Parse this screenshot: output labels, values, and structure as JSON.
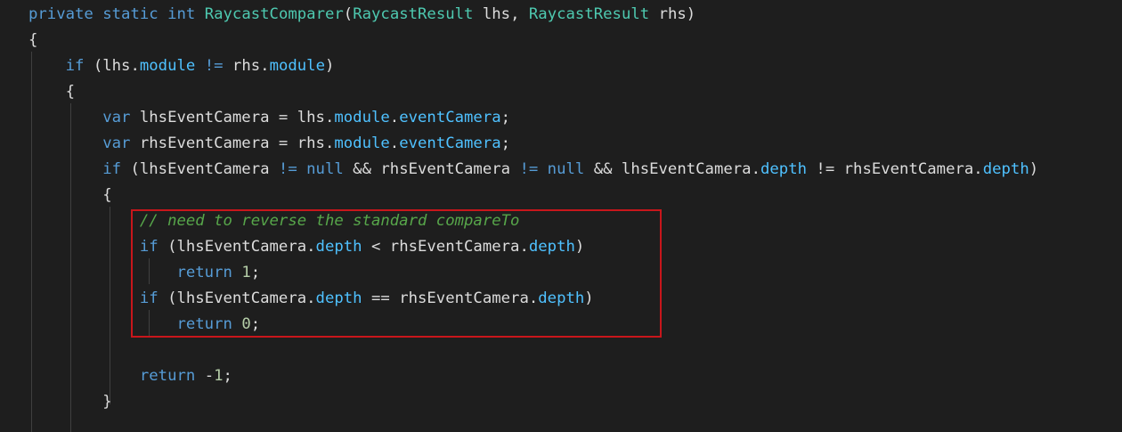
{
  "code": {
    "language": "C#",
    "lines": [
      {
        "tokens": [
          [
            "private",
            "kw"
          ],
          [
            " ",
            ""
          ],
          [
            "static",
            "kw"
          ],
          [
            " ",
            ""
          ],
          [
            "int",
            "kw"
          ],
          [
            " ",
            ""
          ],
          [
            "RaycastComparer",
            "fn"
          ],
          [
            "(",
            ""
          ],
          [
            "RaycastResult",
            "cls"
          ],
          [
            " lhs, ",
            ""
          ],
          [
            "RaycastResult",
            "cls"
          ],
          [
            " rhs)",
            ""
          ]
        ]
      },
      {
        "tokens": [
          [
            "{",
            ""
          ]
        ]
      },
      {
        "tokens": [
          [
            "    ",
            ""
          ],
          [
            "if",
            "kw"
          ],
          [
            " (lhs.",
            ""
          ],
          [
            "module",
            "mem"
          ],
          [
            " ",
            ""
          ],
          [
            "!=",
            "kw"
          ],
          [
            " rhs.",
            ""
          ],
          [
            "module",
            "mem"
          ],
          [
            ")",
            ""
          ]
        ]
      },
      {
        "tokens": [
          [
            "    {",
            ""
          ]
        ]
      },
      {
        "tokens": [
          [
            "        ",
            ""
          ],
          [
            "var",
            "kw"
          ],
          [
            " lhsEventCamera = lhs.",
            ""
          ],
          [
            "module",
            "mem"
          ],
          [
            ".",
            ""
          ],
          [
            "eventCamera",
            "mem"
          ],
          [
            ";",
            ""
          ]
        ]
      },
      {
        "tokens": [
          [
            "        ",
            ""
          ],
          [
            "var",
            "kw"
          ],
          [
            " rhsEventCamera = rhs.",
            ""
          ],
          [
            "module",
            "mem"
          ],
          [
            ".",
            ""
          ],
          [
            "eventCamera",
            "mem"
          ],
          [
            ";",
            ""
          ]
        ]
      },
      {
        "tokens": [
          [
            "        ",
            ""
          ],
          [
            "if",
            "kw"
          ],
          [
            " (lhsEventCamera ",
            ""
          ],
          [
            "!=",
            "kw"
          ],
          [
            " ",
            ""
          ],
          [
            "null",
            "kw"
          ],
          [
            " && rhsEventCamera ",
            ""
          ],
          [
            "!=",
            "kw"
          ],
          [
            " ",
            ""
          ],
          [
            "null",
            "kw"
          ],
          [
            " && lhsEventCamera.",
            ""
          ],
          [
            "depth",
            "mem"
          ],
          [
            " != rhsEventCamera.",
            ""
          ],
          [
            "depth",
            "mem"
          ],
          [
            ")",
            ""
          ]
        ]
      },
      {
        "tokens": [
          [
            "        {",
            ""
          ]
        ]
      },
      {
        "tokens": [
          [
            "            ",
            ""
          ],
          [
            "// need to reverse the standard compareTo",
            "cm"
          ]
        ]
      },
      {
        "tokens": [
          [
            "            ",
            ""
          ],
          [
            "if",
            "kw"
          ],
          [
            " (lhsEventCamera.",
            ""
          ],
          [
            "depth",
            "mem"
          ],
          [
            " < rhsEventCamera.",
            ""
          ],
          [
            "depth",
            "mem"
          ],
          [
            ")",
            ""
          ]
        ]
      },
      {
        "tokens": [
          [
            "                ",
            ""
          ],
          [
            "return",
            "kw"
          ],
          [
            " ",
            ""
          ],
          [
            "1",
            "num"
          ],
          [
            ";",
            ""
          ]
        ]
      },
      {
        "tokens": [
          [
            "            ",
            ""
          ],
          [
            "if",
            "kw"
          ],
          [
            " (lhsEventCamera.",
            ""
          ],
          [
            "depth",
            "mem"
          ],
          [
            " == rhsEventCamera.",
            ""
          ],
          [
            "depth",
            "mem"
          ],
          [
            ")",
            ""
          ]
        ]
      },
      {
        "tokens": [
          [
            "                ",
            ""
          ],
          [
            "return",
            "kw"
          ],
          [
            " ",
            ""
          ],
          [
            "0",
            "num"
          ],
          [
            ";",
            ""
          ]
        ]
      },
      {
        "tokens": [
          [
            "",
            ""
          ]
        ]
      },
      {
        "tokens": [
          [
            "            ",
            ""
          ],
          [
            "return",
            "kw"
          ],
          [
            " -",
            ""
          ],
          [
            "1",
            "num"
          ],
          [
            ";",
            ""
          ]
        ]
      },
      {
        "tokens": [
          [
            "        }",
            ""
          ]
        ]
      }
    ]
  },
  "colors": {
    "background": "#1e1e1e",
    "keyword": "#569cd6",
    "member": "#4fc1ff",
    "type": "#4ec9b0",
    "comment": "#57a64a",
    "number": "#b5cea8",
    "highlight_border": "#c8161b"
  }
}
